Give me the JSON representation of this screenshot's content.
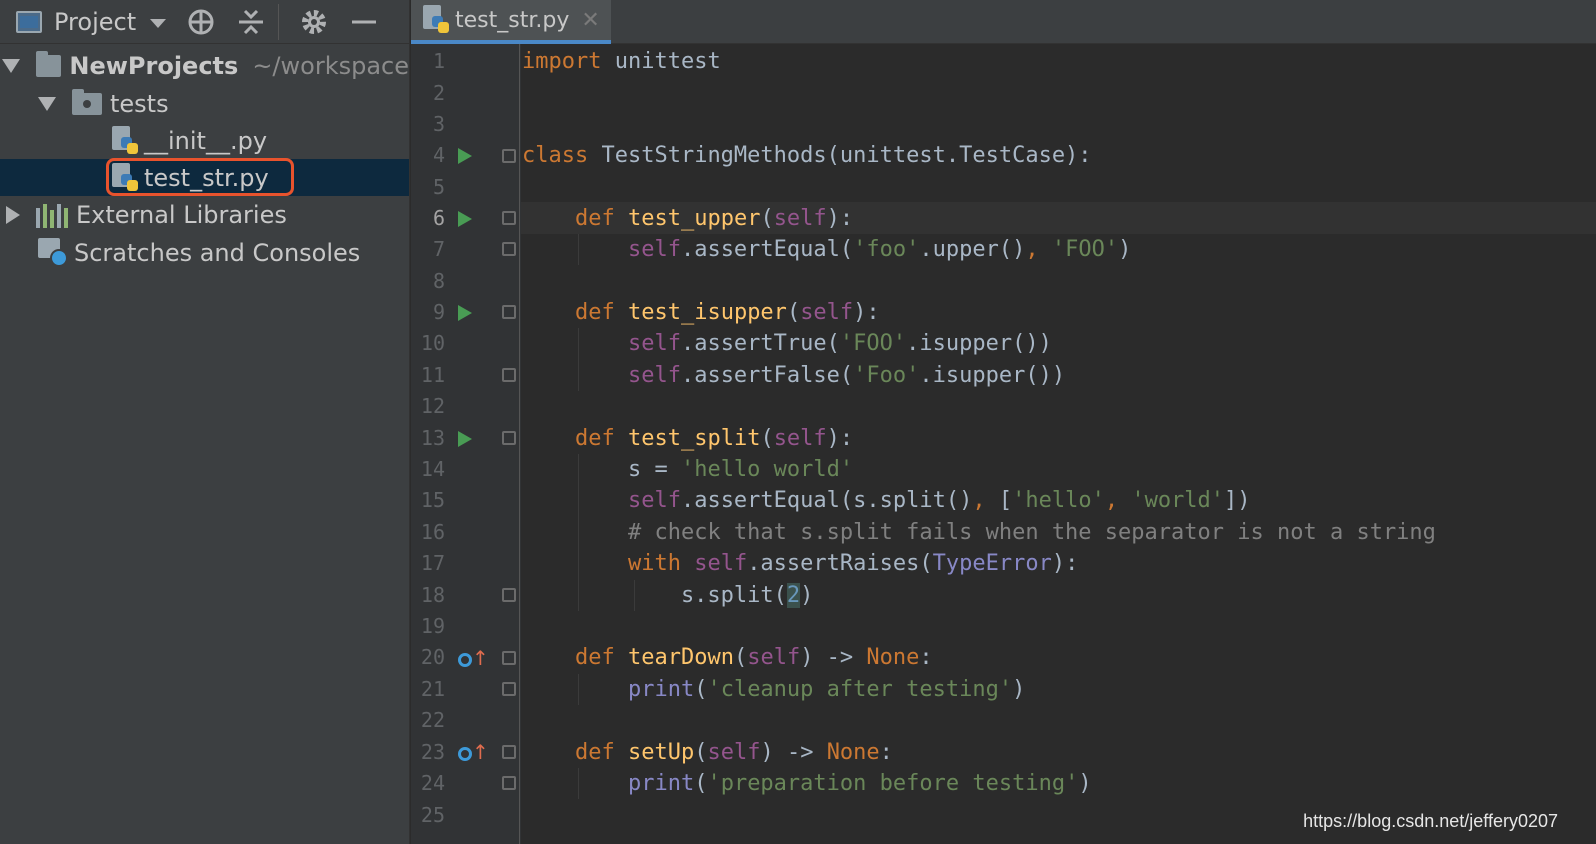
{
  "project_panel": {
    "title": "Project",
    "tree": [
      {
        "label": "NewProjects",
        "suffix": "~/workspace",
        "icon": "folder-icon"
      },
      {
        "label": "tests",
        "icon": "package-folder-icon"
      },
      {
        "label": "__init__.py",
        "icon": "python-file-icon"
      },
      {
        "label": "test_str.py",
        "icon": "python-file-icon",
        "selected": true
      },
      {
        "label": "External Libraries",
        "icon": "libraries-icon"
      },
      {
        "label": "Scratches and Consoles",
        "icon": "scratches-icon"
      }
    ]
  },
  "editor": {
    "tab_label": "test_str.py",
    "current_line": 6,
    "lines": [
      "import unittest",
      "",
      "",
      "class TestStringMethods(unittest.TestCase):",
      "",
      "    def test_upper(self):",
      "        self.assertEqual('foo'.upper(), 'FOO')",
      "",
      "    def test_isupper(self):",
      "        self.assertTrue('FOO'.isupper())",
      "        self.assertFalse('Foo'.isupper())",
      "",
      "    def test_split(self):",
      "        s = 'hello world'",
      "        self.assertEqual(s.split(), ['hello', 'world'])",
      "        # check that s.split fails when the separator is not a string",
      "        with self.assertRaises(TypeError):",
      "            s.split(2)",
      "",
      "    def tearDown(self) -> None:",
      "        print('cleanup after testing')",
      "",
      "    def setUp(self) -> None:",
      "        print('preparation before testing')",
      ""
    ],
    "line_numbers": [
      "1",
      "2",
      "3",
      "4",
      "5",
      "6",
      "7",
      "8",
      "9",
      "10",
      "11",
      "12",
      "13",
      "14",
      "15",
      "16",
      "17",
      "18",
      "19",
      "20",
      "21",
      "22",
      "23",
      "24",
      "25"
    ]
  },
  "watermark": "https://blog.csdn.net/jeffery0207",
  "colors": {
    "keyword": "#cc7832",
    "function": "#ffc66d",
    "self": "#94558d",
    "string": "#6a8759",
    "comment": "#808080",
    "run_gutter": "#499c54",
    "highlight_box": "#e8532d"
  }
}
